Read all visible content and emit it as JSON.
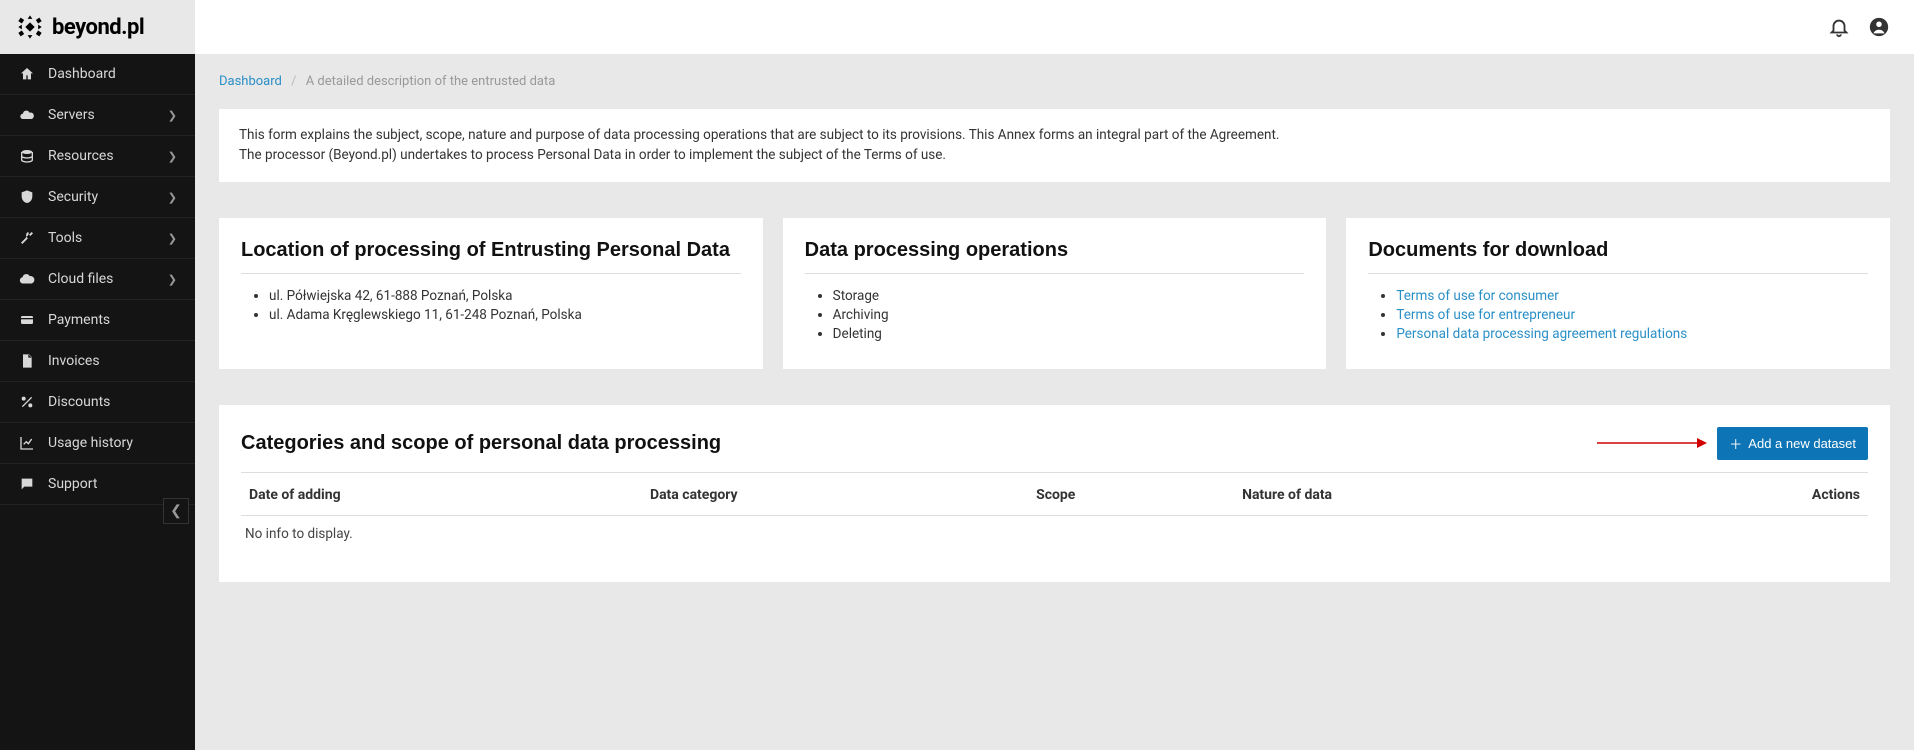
{
  "brand": {
    "name": "beyond.pl"
  },
  "sidebar": {
    "items": [
      {
        "label": "Dashboard",
        "expandable": false
      },
      {
        "label": "Servers",
        "expandable": true
      },
      {
        "label": "Resources",
        "expandable": true
      },
      {
        "label": "Security",
        "expandable": true
      },
      {
        "label": "Tools",
        "expandable": true
      },
      {
        "label": "Cloud files",
        "expandable": true
      },
      {
        "label": "Payments",
        "expandable": false
      },
      {
        "label": "Invoices",
        "expandable": false
      },
      {
        "label": "Discounts",
        "expandable": false
      },
      {
        "label": "Usage history",
        "expandable": false
      },
      {
        "label": "Support",
        "expandable": false
      }
    ]
  },
  "breadcrumb": {
    "root": "Dashboard",
    "current": "A detailed description of the entrusted data"
  },
  "intro": {
    "line1": "This form explains the subject, scope, nature and purpose of data processing operations that are subject to its provisions. This Annex forms an integral part of the Agreement.",
    "line2": "The processor (Beyond.pl) undertakes to process Personal Data in order to implement the subject of the Terms of use."
  },
  "cards": {
    "location": {
      "title": "Location of processing of Entrusting Personal Data",
      "items": [
        "ul. Półwiejska 42, 61-888 Poznań, Polska",
        "ul. Adama Kręglewskiego 11, 61-248 Poznań, Polska"
      ]
    },
    "operations": {
      "title": "Data processing operations",
      "items": [
        "Storage",
        "Archiving",
        "Deleting"
      ]
    },
    "documents": {
      "title": "Documents for download",
      "items": [
        "Terms of use for consumer",
        "Terms of use for entrepreneur",
        "Personal data processing agreement regulations"
      ]
    }
  },
  "categories": {
    "title": "Categories and scope of personal data processing",
    "add_button": "Add a new dataset",
    "columns": {
      "date": "Date of adding",
      "category": "Data category",
      "scope": "Scope",
      "nature": "Nature of data",
      "actions": "Actions"
    },
    "empty": "No info to display."
  }
}
